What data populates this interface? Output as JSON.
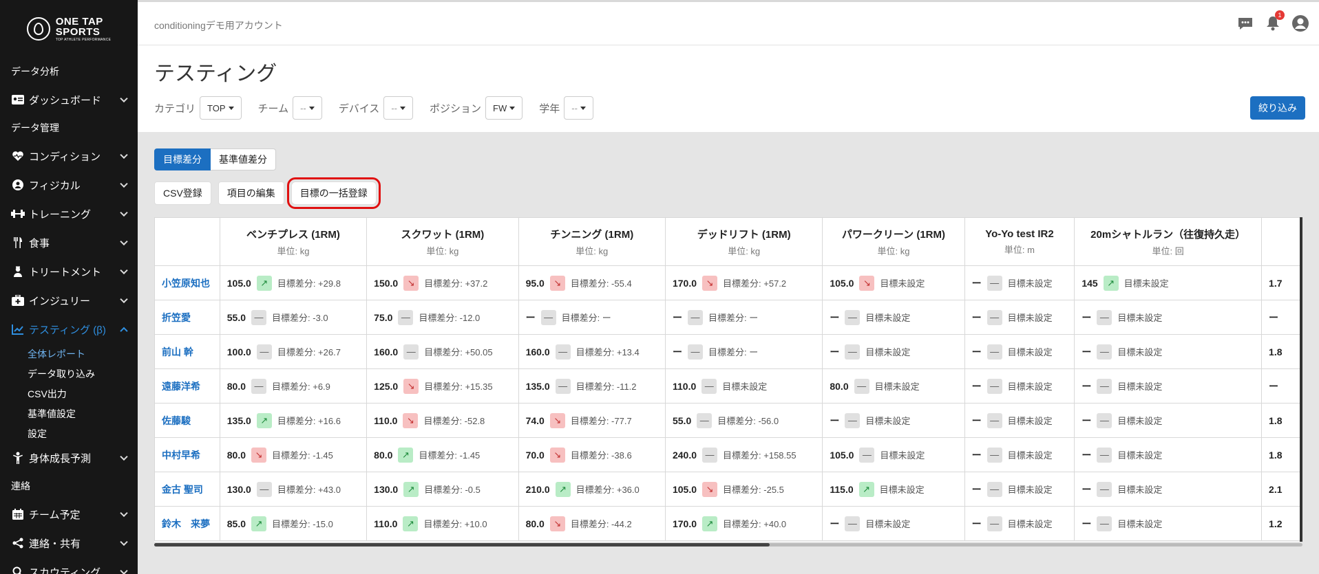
{
  "brand": {
    "line1": "ONE TAP",
    "line2": "SPORTS",
    "tagline": "TOP ATHLETE PERFORMANCE"
  },
  "sidebar": {
    "items": [
      {
        "type": "section",
        "label": "データ分析"
      },
      {
        "type": "item",
        "label": "ダッシュボード",
        "icon": "id-card-icon"
      },
      {
        "type": "section",
        "label": "データ管理"
      },
      {
        "type": "item",
        "label": "コンディション",
        "icon": "heart-icon"
      },
      {
        "type": "item",
        "label": "フィジカル",
        "icon": "user-circle-icon"
      },
      {
        "type": "item",
        "label": "トレーニング",
        "icon": "dumbbell-icon"
      },
      {
        "type": "item",
        "label": "食事",
        "icon": "utensils-icon"
      },
      {
        "type": "item",
        "label": "トリートメント",
        "icon": "user-nurse-icon"
      },
      {
        "type": "item",
        "label": "インジュリー",
        "icon": "medkit-icon"
      },
      {
        "type": "item",
        "label": "テスティング (β)",
        "icon": "chart-line-icon",
        "active": true
      },
      {
        "type": "sub",
        "label": "全体レポート",
        "active": true
      },
      {
        "type": "sub",
        "label": "データ取り込み"
      },
      {
        "type": "sub",
        "label": "CSV出力"
      },
      {
        "type": "sub",
        "label": "基準値設定"
      },
      {
        "type": "sub",
        "label": "設定"
      },
      {
        "type": "item",
        "label": "身体成長予測",
        "icon": "child-icon"
      },
      {
        "type": "section",
        "label": "連絡"
      },
      {
        "type": "item",
        "label": "チーム予定",
        "icon": "calendar-icon"
      },
      {
        "type": "item",
        "label": "連絡・共有",
        "icon": "share-icon"
      },
      {
        "type": "item",
        "label": "スカウティング",
        "icon": "search-icon"
      }
    ]
  },
  "topbar": {
    "account": "conditioningデモ用アカウント",
    "notification_count": "1"
  },
  "page": {
    "title": "テスティング"
  },
  "filters": [
    {
      "label": "カテゴリ",
      "value": "TOP"
    },
    {
      "label": "チーム",
      "value": "--"
    },
    {
      "label": "デバイス",
      "value": "--"
    },
    {
      "label": "ポジション",
      "value": "FW"
    },
    {
      "label": "学年",
      "value": "--"
    }
  ],
  "filter_button": "絞り込み",
  "toggle": {
    "on": "目標差分",
    "off": "基準値差分"
  },
  "actions": {
    "csv": "CSV登録",
    "edit": "項目の編集",
    "bulk": "目標の一括登録"
  },
  "columns": [
    {
      "title": "ベンチプレス (1RM)",
      "unit": "単位: kg"
    },
    {
      "title": "スクワット (1RM)",
      "unit": "単位: kg"
    },
    {
      "title": "チンニング (1RM)",
      "unit": "単位: kg"
    },
    {
      "title": "デッドリフト (1RM)",
      "unit": "単位: kg"
    },
    {
      "title": "パワークリーン (1RM)",
      "unit": "単位: kg"
    },
    {
      "title": "Yo-Yo test IR2",
      "unit": "単位: m"
    },
    {
      "title": "20mシャトルラン（往復持久走）",
      "unit": "単位: 回"
    }
  ],
  "rows": [
    {
      "name": "小笠原知也",
      "cells": [
        {
          "v": "105.0",
          "t": "up",
          "d": "目標差分: +29.8"
        },
        {
          "v": "150.0",
          "t": "down",
          "d": "目標差分: +37.2"
        },
        {
          "v": "95.0",
          "t": "down",
          "d": "目標差分: -55.4"
        },
        {
          "v": "170.0",
          "t": "down",
          "d": "目標差分: +57.2"
        },
        {
          "v": "105.0",
          "t": "down",
          "d": "目標未設定"
        },
        {
          "v": "ー",
          "t": "flat",
          "d": "目標未設定"
        },
        {
          "v": "145",
          "t": "up",
          "d": "目標未設定"
        }
      ],
      "extra": "1.7"
    },
    {
      "name": "折笠愛",
      "cells": [
        {
          "v": "55.0",
          "t": "flat",
          "d": "目標差分: -3.0"
        },
        {
          "v": "75.0",
          "t": "flat",
          "d": "目標差分: -12.0"
        },
        {
          "v": "ー",
          "t": "flat",
          "d": "目標差分: ー"
        },
        {
          "v": "ー",
          "t": "flat",
          "d": "目標差分: ー"
        },
        {
          "v": "ー",
          "t": "flat",
          "d": "目標未設定"
        },
        {
          "v": "ー",
          "t": "flat",
          "d": "目標未設定"
        },
        {
          "v": "ー",
          "t": "flat",
          "d": "目標未設定"
        }
      ],
      "extra": "ー"
    },
    {
      "name": "前山 幹",
      "cells": [
        {
          "v": "100.0",
          "t": "flat",
          "d": "目標差分: +26.7"
        },
        {
          "v": "160.0",
          "t": "flat",
          "d": "目標差分: +50.05"
        },
        {
          "v": "160.0",
          "t": "flat",
          "d": "目標差分: +13.4"
        },
        {
          "v": "ー",
          "t": "flat",
          "d": "目標差分: ー"
        },
        {
          "v": "ー",
          "t": "flat",
          "d": "目標未設定"
        },
        {
          "v": "ー",
          "t": "flat",
          "d": "目標未設定"
        },
        {
          "v": "ー",
          "t": "flat",
          "d": "目標未設定"
        }
      ],
      "extra": "1.8"
    },
    {
      "name": "遠藤洋希",
      "cells": [
        {
          "v": "80.0",
          "t": "flat",
          "d": "目標差分: +6.9"
        },
        {
          "v": "125.0",
          "t": "down",
          "d": "目標差分: +15.35"
        },
        {
          "v": "135.0",
          "t": "flat",
          "d": "目標差分: -11.2"
        },
        {
          "v": "110.0",
          "t": "flat",
          "d": "目標未設定"
        },
        {
          "v": "80.0",
          "t": "flat",
          "d": "目標未設定"
        },
        {
          "v": "ー",
          "t": "flat",
          "d": "目標未設定"
        },
        {
          "v": "ー",
          "t": "flat",
          "d": "目標未設定"
        }
      ],
      "extra": "ー"
    },
    {
      "name": "佐藤駿",
      "cells": [
        {
          "v": "135.0",
          "t": "up",
          "d": "目標差分: +16.6"
        },
        {
          "v": "110.0",
          "t": "down",
          "d": "目標差分: -52.8"
        },
        {
          "v": "74.0",
          "t": "down",
          "d": "目標差分: -77.7"
        },
        {
          "v": "55.0",
          "t": "flat",
          "d": "目標差分: -56.0"
        },
        {
          "v": "ー",
          "t": "flat",
          "d": "目標未設定"
        },
        {
          "v": "ー",
          "t": "flat",
          "d": "目標未設定"
        },
        {
          "v": "ー",
          "t": "flat",
          "d": "目標未設定"
        }
      ],
      "extra": "1.8"
    },
    {
      "name": "中村早希",
      "cells": [
        {
          "v": "80.0",
          "t": "down",
          "d": "目標差分: -1.45"
        },
        {
          "v": "80.0",
          "t": "up",
          "d": "目標差分: -1.45"
        },
        {
          "v": "70.0",
          "t": "down",
          "d": "目標差分: -38.6"
        },
        {
          "v": "240.0",
          "t": "flat",
          "d": "目標差分: +158.55"
        },
        {
          "v": "105.0",
          "t": "flat",
          "d": "目標未設定"
        },
        {
          "v": "ー",
          "t": "flat",
          "d": "目標未設定"
        },
        {
          "v": "ー",
          "t": "flat",
          "d": "目標未設定"
        }
      ],
      "extra": "1.8"
    },
    {
      "name": "金古 聖司",
      "cells": [
        {
          "v": "130.0",
          "t": "flat",
          "d": "目標差分: +43.0"
        },
        {
          "v": "130.0",
          "t": "up",
          "d": "目標差分: -0.5"
        },
        {
          "v": "210.0",
          "t": "up",
          "d": "目標差分: +36.0"
        },
        {
          "v": "105.0",
          "t": "down",
          "d": "目標差分: -25.5"
        },
        {
          "v": "115.0",
          "t": "up",
          "d": "目標未設定"
        },
        {
          "v": "ー",
          "t": "flat",
          "d": "目標未設定"
        },
        {
          "v": "ー",
          "t": "flat",
          "d": "目標未設定"
        }
      ],
      "extra": "2.1"
    },
    {
      "name": "鈴木　来夢",
      "cells": [
        {
          "v": "85.0",
          "t": "up",
          "d": "目標差分: -15.0"
        },
        {
          "v": "110.0",
          "t": "up",
          "d": "目標差分: +10.0"
        },
        {
          "v": "80.0",
          "t": "down",
          "d": "目標差分: -44.2"
        },
        {
          "v": "170.0",
          "t": "up",
          "d": "目標差分: +40.0"
        },
        {
          "v": "ー",
          "t": "flat",
          "d": "目標未設定"
        },
        {
          "v": "ー",
          "t": "flat",
          "d": "目標未設定"
        },
        {
          "v": "ー",
          "t": "flat",
          "d": "目標未設定"
        }
      ],
      "extra": "1.2"
    }
  ]
}
